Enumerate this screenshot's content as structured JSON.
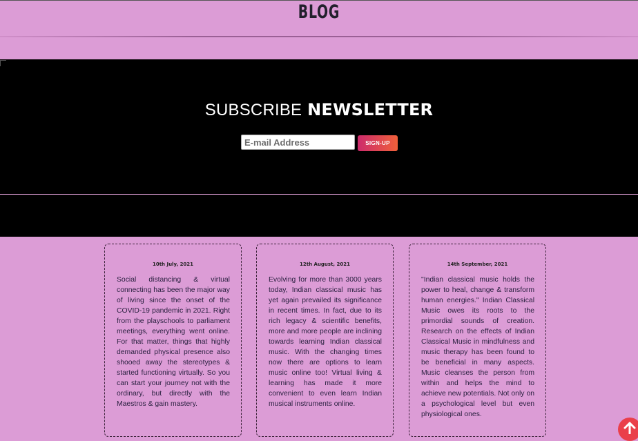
{
  "header": {
    "title": "BLOG"
  },
  "newsletter": {
    "heading_light": "SUBSCRIBE",
    "heading_bold": "NEWSLETTER",
    "email_placeholder": "E-mail Address",
    "signup_label": "SIGN-UP"
  },
  "cards": [
    {
      "date": "10th July, 2021",
      "body": "Social distancing & virtual connecting has been the major way of living since the onset of the COVID-19 pandemic in 2021. Right from the playschools to parliament meetings, everything went online. For that matter, things that highly demanded physical presence also shooed away the stereotypes & started functioning virtually. So you can start your journey not with the ordinary, but directly with the Maestros & gain mastery."
    },
    {
      "date": "12th August, 2021",
      "body": "Evolving for more than 3000 years today, Indian classical music has yet again prevailed its significance in recent times. In fact, due to its rich legacy & scientific benefits, more and more people are inclining towards learning Indian classical music. With the changing times now there are options to learn music online too! Virtual living & learning has made it more convenient to even learn Indian musical instruments online."
    },
    {
      "date": "14th September, 2021",
      "body": "\"Indian classical music holds the power to heal, change & transform human energies.\" Indian Classical Music owes its roots to the primordial sounds of creation. Research on the effects of Indian Classical Music in mindfulness and music therapy has been found to be beneficial in many aspects. Music cleanses the person from within and helps the mind to achieve new potentials. Not only on a psychological level but even physiological ones."
    }
  ],
  "colors": {
    "page_bg": "#dc9cd6",
    "newsletter_bg": "#000000",
    "signup_gradient_start": "#cc2b6c",
    "signup_gradient_end": "#f0603a",
    "scroll_top_bg": "#ea3f4a"
  },
  "icons": {
    "scroll_top": "arrow-up-icon",
    "broken_image": "broken-image-icon"
  }
}
